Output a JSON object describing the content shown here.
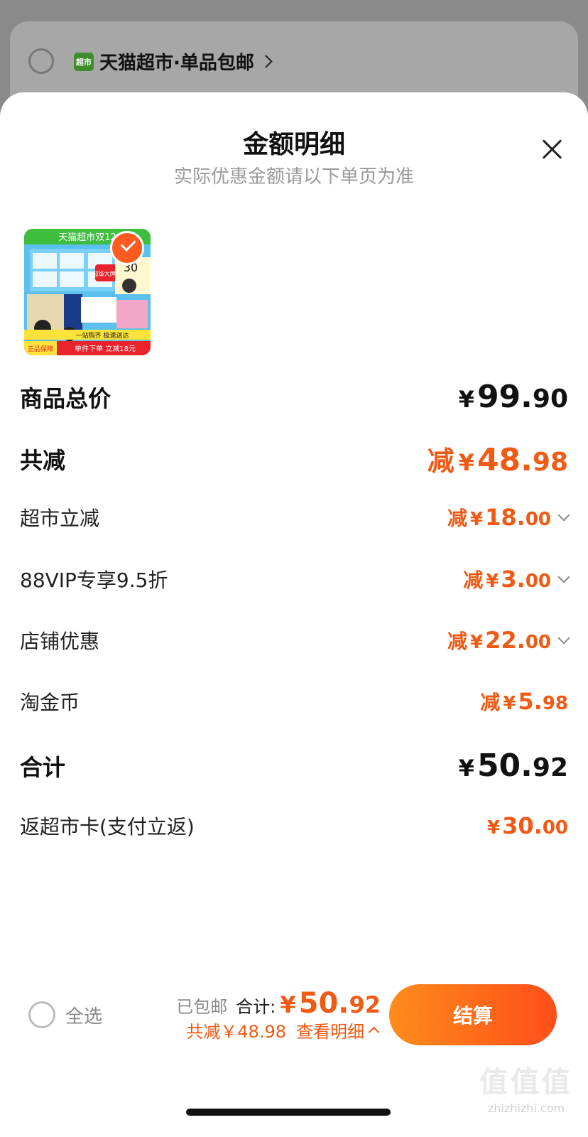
{
  "background": {
    "shop_badge": "超市",
    "shop_name": "天猫超市·单品包邮"
  },
  "sheet": {
    "title": "金额明细",
    "subtitle": "实际优惠金额请以下单页为准"
  },
  "product": {
    "thumbnail_texts": {
      "banner": "天猫超市双12",
      "promo": "超级大牌 不可分隔",
      "coupon": "30",
      "cart_strip": "一站购齐 极速送达",
      "bottom_strip": "单件下单 立减18元",
      "tag": "正品保障"
    },
    "selected": true
  },
  "breakdown": {
    "total_label": "商品总价",
    "total_currency": "¥",
    "total_int": "99.",
    "total_dec": "90",
    "discount_label": "共减",
    "discount_prefix": "减",
    "discount_currency": "¥",
    "discount_int": "48.",
    "discount_dec": "98",
    "items": [
      {
        "label": "超市立减",
        "prefix": "减",
        "currency": "¥",
        "int": "18.",
        "dec": "00",
        "expandable": true
      },
      {
        "label": "88VIP专享9.5折",
        "prefix": "减",
        "currency": "¥",
        "int": "3.",
        "dec": "00",
        "expandable": true
      },
      {
        "label": "店铺优惠",
        "prefix": "减",
        "currency": "¥",
        "int": "22.",
        "dec": "00",
        "expandable": true
      },
      {
        "label": "淘金币",
        "prefix": "减",
        "currency": "¥",
        "int": "5.",
        "dec": "98",
        "expandable": false
      }
    ],
    "sum_label": "合计",
    "sum_currency": "¥",
    "sum_int": "50.",
    "sum_dec": "92",
    "rebate_label": "返超市卡(支付立返)",
    "rebate_currency": "¥",
    "rebate_int": "30.",
    "rebate_dec": "00"
  },
  "footer": {
    "select_all": "全选",
    "shipping": "已包邮",
    "total_label": "合计:",
    "total_currency": "¥",
    "total_int": "50.",
    "total_dec": "92",
    "saved": "共减￥48.98",
    "detail_link": "查看明细",
    "checkout": "结算"
  },
  "watermark": {
    "big": "值值值",
    "small": "zhizhizhi.com"
  },
  "colors": {
    "accent": "#f05a14",
    "checkout_start": "#ff8c1a",
    "checkout_end": "#ff4d1a"
  }
}
